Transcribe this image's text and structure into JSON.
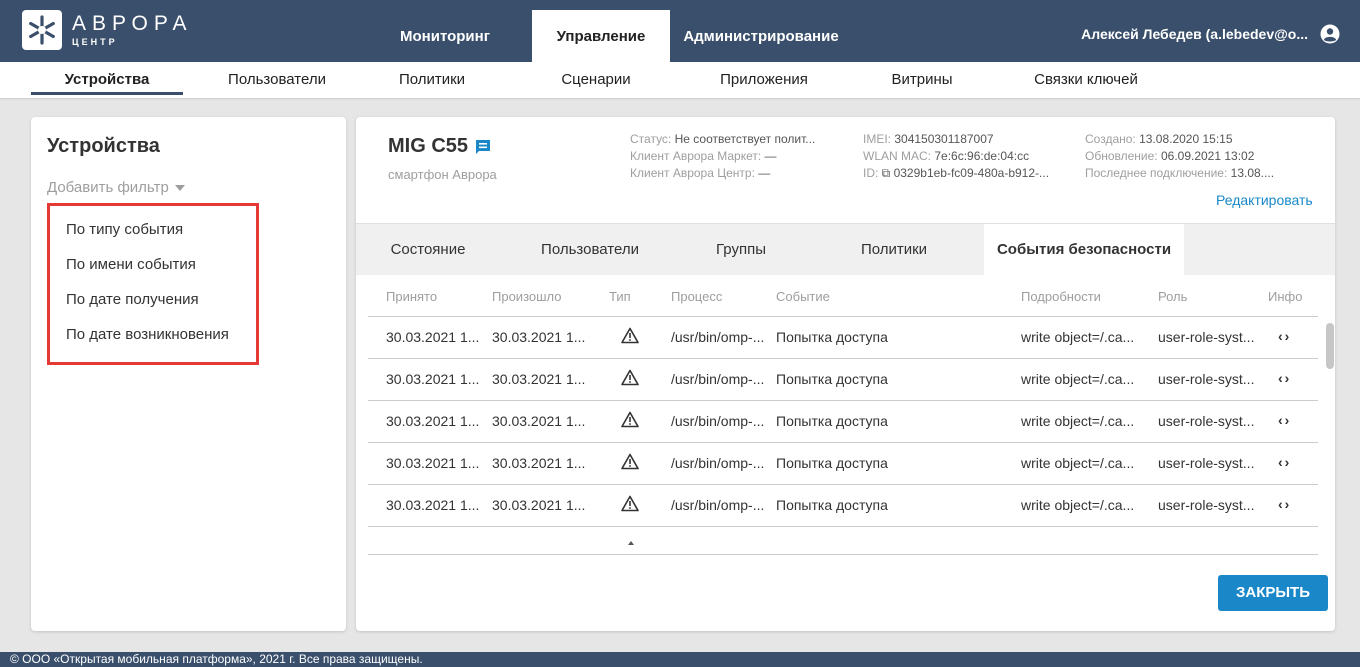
{
  "colors": {
    "header": "#3a4f6b",
    "accent": "#1a88c8",
    "highlight": "#e53935"
  },
  "logo": {
    "title": "АВРОРА",
    "subtitle": "ЦЕНТР",
    "icon": "snowflake-icon"
  },
  "topnav": [
    {
      "label": "Мониторинг"
    },
    {
      "label": "Управление"
    },
    {
      "label": "Администрирование"
    }
  ],
  "user": {
    "name": "Алексей Лебедев (a.lebedev@o...",
    "icon": "user-circle-icon"
  },
  "subnav": [
    {
      "label": "Устройства"
    },
    {
      "label": "Пользователи"
    },
    {
      "label": "Политики"
    },
    {
      "label": "Сценарии"
    },
    {
      "label": "Приложения"
    },
    {
      "label": "Витрины"
    },
    {
      "label": "Связки ключей"
    }
  ],
  "left_panel": {
    "title": "Устройства",
    "add_filter": "Добавить фильтр",
    "filters": [
      "По типу события",
      "По имени события",
      "По дате получения",
      "По дате возникновения"
    ]
  },
  "device": {
    "name": "MIG C55",
    "type": "смартфон Аврора",
    "status_label": "Статус: ",
    "status_value": "Не соответствует полит...",
    "market_client_label": "Клиент Аврора Маркет: ",
    "market_client_value": "—",
    "center_client_label": "Клиент Аврора Центр: ",
    "center_client_value": "—",
    "imei_label": "IMEI: ",
    "imei_value": "304150301187007",
    "wlan_label": "WLAN MAC: ",
    "wlan_value": "7e:6c:96:de:04:cc",
    "id_label": "ID: ",
    "id_value": "0329b1eb-fc09-480a-b912-...",
    "created_label": "Создано: ",
    "created_value": "13.08.2020 15:15",
    "updated_label": "Обновление: ",
    "updated_value": "06.09.2021 13:02",
    "last_conn_label": "Последнее подключение: ",
    "last_conn_value": "13.08....",
    "edit": "Редактировать"
  },
  "tabs": [
    {
      "label": "Состояние"
    },
    {
      "label": "Пользователи"
    },
    {
      "label": "Группы"
    },
    {
      "label": "Политики"
    },
    {
      "label": "События безопасности"
    }
  ],
  "table": {
    "headers": [
      "Принято",
      "Произошло",
      "Тип",
      "Процесс",
      "Событие",
      "Подробности",
      "Роль",
      "Инфо"
    ],
    "rows": [
      {
        "received": "30.03.2021 1...",
        "occurred": "30.03.2021 1...",
        "process": "/usr/bin/omp-...",
        "event": "Попытка доступа",
        "details": "write object=/.ca...",
        "role": "user-role-syst..."
      },
      {
        "received": "30.03.2021 1...",
        "occurred": "30.03.2021 1...",
        "process": "/usr/bin/omp-...",
        "event": "Попытка доступа",
        "details": "write object=/.ca...",
        "role": "user-role-syst..."
      },
      {
        "received": "30.03.2021 1...",
        "occurred": "30.03.2021 1...",
        "process": "/usr/bin/omp-...",
        "event": "Попытка доступа",
        "details": "write object=/.ca...",
        "role": "user-role-syst..."
      },
      {
        "received": "30.03.2021 1...",
        "occurred": "30.03.2021 1...",
        "process": "/usr/bin/omp-...",
        "event": "Попытка доступа",
        "details": "write object=/.ca...",
        "role": "user-role-syst..."
      },
      {
        "received": "30.03.2021 1...",
        "occurred": "30.03.2021 1...",
        "process": "/usr/bin/omp-...",
        "event": "Попытка доступа",
        "details": "write object=/.ca...",
        "role": "user-role-syst..."
      }
    ],
    "info_icon": "‹›"
  },
  "close_button": "ЗАКРЫТЬ",
  "footer": "© ООО «Открытая мобильная платформа», 2021 г. Все права защищены."
}
